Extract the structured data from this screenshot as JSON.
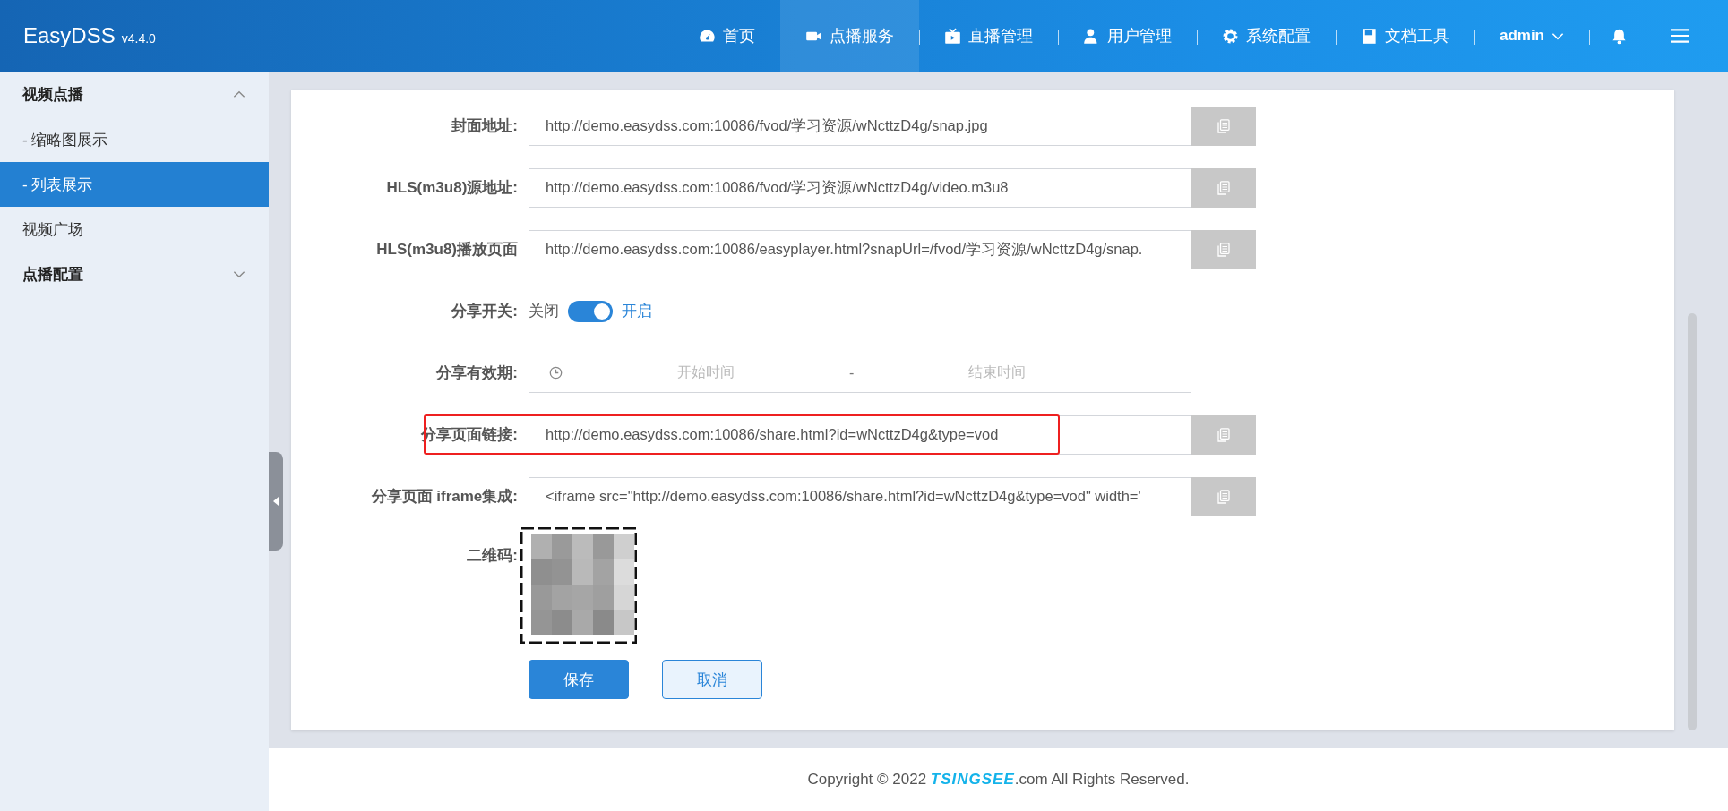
{
  "header": {
    "logo": "EasyDSS",
    "version": "v4.4.0",
    "nav": [
      {
        "label": "首页",
        "selected": false
      },
      {
        "label": "点播服务",
        "selected": true
      },
      {
        "label": "直播管理",
        "selected": false
      },
      {
        "label": "用户管理",
        "selected": false
      },
      {
        "label": "系统配置",
        "selected": false
      },
      {
        "label": "文档工具",
        "selected": false
      }
    ],
    "user": "admin"
  },
  "sidebar": {
    "groups": [
      {
        "label": "视频点播",
        "expanded": true,
        "children": [
          {
            "label": "- 缩略图展示",
            "selected": false
          },
          {
            "label": "- 列表展示",
            "selected": true
          },
          {
            "label": "视频广场",
            "selected": false
          }
        ]
      },
      {
        "label": "点播配置",
        "expanded": false
      }
    ]
  },
  "form": {
    "rows": [
      {
        "kind": "url",
        "label": "封面地址:",
        "value": "http://demo.easydss.com:10086/fvod/学习资源/wNcttzD4g/snap.jpg",
        "highlighted": false
      },
      {
        "kind": "url",
        "label": "HLS(m3u8)源地址:",
        "value": "http://demo.easydss.com:10086/fvod/学习资源/wNcttzD4g/video.m3u8",
        "highlighted": false
      },
      {
        "kind": "url",
        "label": "HLS(m3u8)播放页面",
        "value": "http://demo.easydss.com:10086/easyplayer.html?snapUrl=/fvod/学习资源/wNcttzD4g/snap.",
        "highlighted": false
      },
      {
        "kind": "switch",
        "label": "分享开关:",
        "off_label": "关闭",
        "on_label": "开启",
        "on": true
      },
      {
        "kind": "daterange",
        "label": "分享有效期:",
        "start_placeholder": "开始时间",
        "separator": "-",
        "end_placeholder": "结束时间"
      },
      {
        "kind": "url",
        "label": "分享页面链接:",
        "value": "http://demo.easydss.com:10086/share.html?id=wNcttzD4g&type=vod",
        "highlighted": true
      },
      {
        "kind": "url",
        "label": "分享页面 iframe集成:",
        "value": "<iframe src=\"http://demo.easydss.com:10086/share.html?id=wNcttzD4g&type=vod\" width='",
        "highlighted": false
      },
      {
        "kind": "qr",
        "label": "二维码:"
      }
    ],
    "buttons": [
      {
        "kind": "primary",
        "label": "保存"
      },
      {
        "kind": "secondary",
        "label": "取消"
      }
    ]
  },
  "footer": {
    "before": "Copyright © 2022 ",
    "brand": "TSINGSEE",
    "after": ".com All Rights Reserved."
  }
}
